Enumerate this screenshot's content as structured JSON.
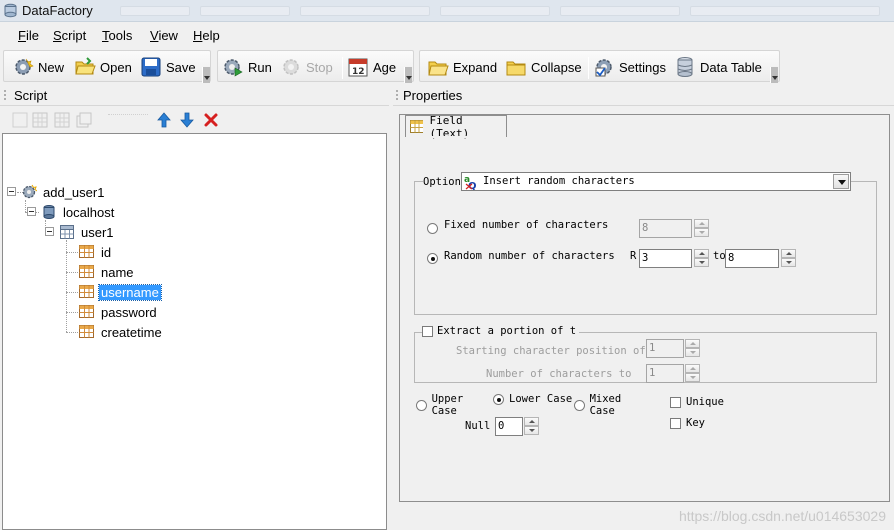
{
  "window": {
    "title": "DataFactory"
  },
  "menu": [
    {
      "label": "File",
      "mnemonic_index": 0
    },
    {
      "label": "Script",
      "mnemonic_index": 0
    },
    {
      "label": "Tools",
      "mnemonic_index": 0
    },
    {
      "label": "View",
      "mnemonic_index": 0
    },
    {
      "label": "Help",
      "mnemonic_index": 0
    }
  ],
  "toolbar": {
    "new": "New",
    "open": "Open",
    "save": "Save",
    "run": "Run",
    "stop": "Stop",
    "age": "Age",
    "expand": "Expand",
    "collapse": "Collapse",
    "settings": "Settings",
    "data_table": "Data Table"
  },
  "script_panel": {
    "title": "Script",
    "tree": {
      "root": "add_user1",
      "server": "localhost",
      "table": "user1",
      "fields": [
        "id",
        "name",
        "username",
        "password",
        "createtime"
      ],
      "selected": "username"
    }
  },
  "properties_panel": {
    "title": "Properties",
    "tab": "Field (Text)",
    "option_label": "Option",
    "option_value": "Insert random characters",
    "fixed_label": "Fixed number of characters",
    "fixed_value": "8",
    "random_label": "Random number of characters",
    "random_r": "R",
    "random_from": "3",
    "random_to_label": "to",
    "random_to": "8",
    "random_selected": true,
    "extract_label": "Extract a portion of t",
    "start_label": "Starting character position of",
    "start_value": "1",
    "count_label": "Number of characters to",
    "count_value": "1",
    "upper_case": "Upper Case",
    "lower_case": "Lower Case",
    "mixed_case": "Mixed Case",
    "case_selected": "Lower Case",
    "unique": "Unique",
    "key": "Key",
    "null_label": "Null",
    "null_value": "0"
  },
  "watermark": "https://blog.csdn.net/u014653029",
  "colors": {
    "selection": "#3399ff",
    "delete_red": "#d62020",
    "arrow_blue": "#2a7fd4"
  }
}
